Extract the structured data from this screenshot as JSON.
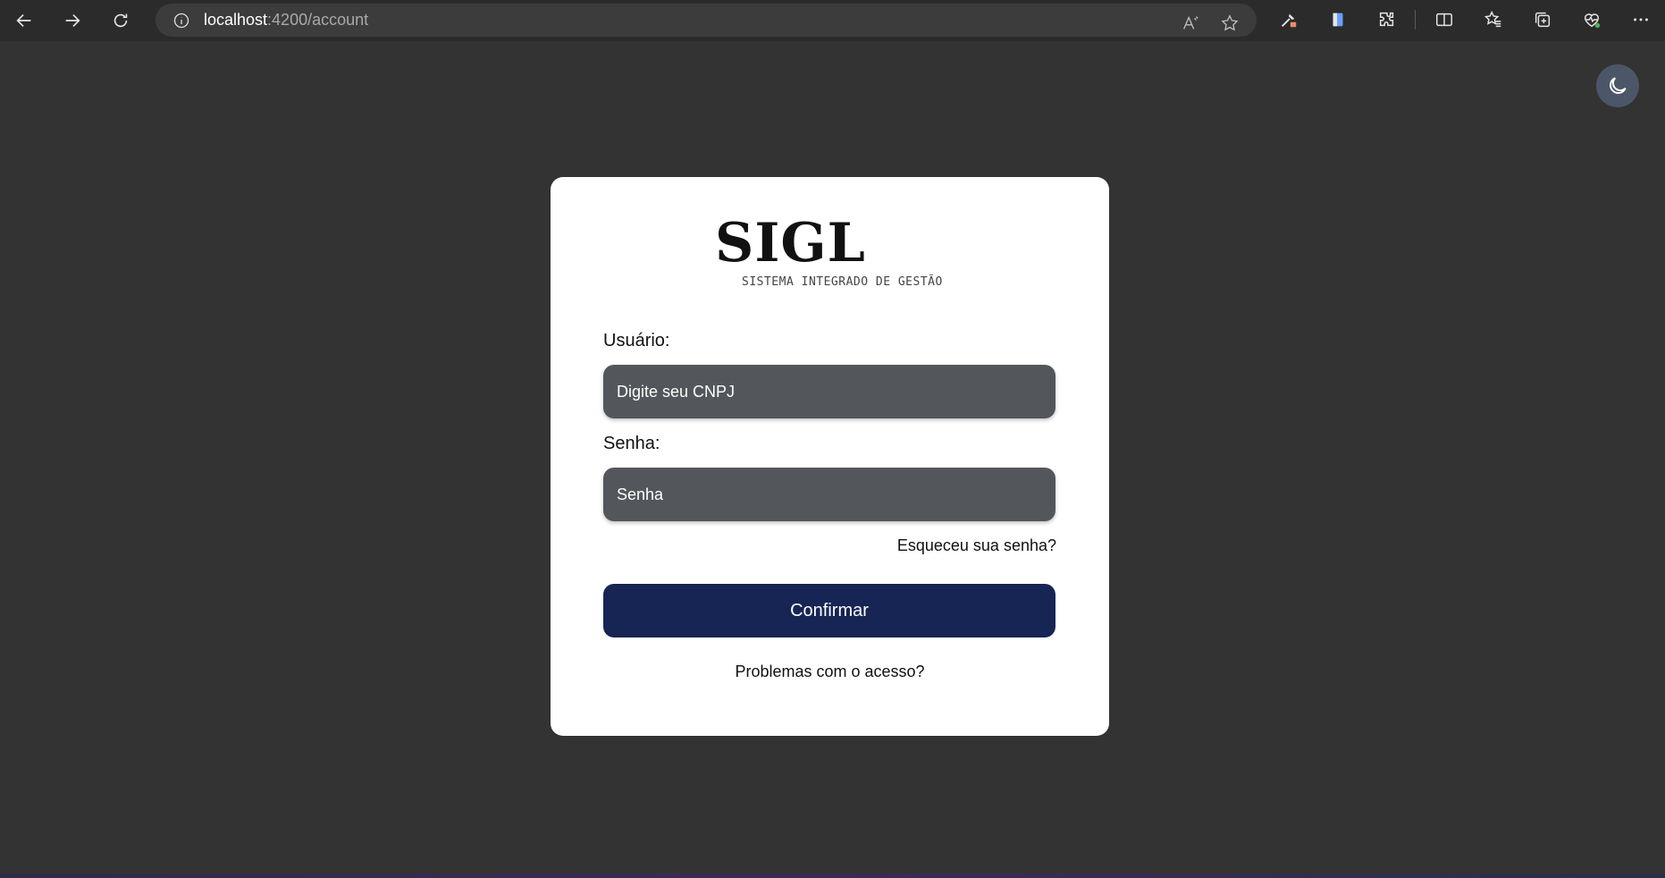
{
  "browser": {
    "url_host": "localhost",
    "url_rest": ":4200/account"
  },
  "login": {
    "logo_title": "SIGL",
    "logo_subtitle": "SISTEMA INTEGRADO DE GESTÃO",
    "user_label": "Usuário:",
    "user_placeholder": "Digite seu CNPJ",
    "password_label": "Senha:",
    "password_placeholder": "Senha",
    "forgot_link": "Esqueceu sua senha?",
    "confirm_label": "Confirmar",
    "problems_link": "Problemas com o acesso?"
  },
  "icons": {
    "theme_toggle": "moon-icon"
  },
  "colors": {
    "background": "#333333",
    "card": "#ffffff",
    "input_bg": "#53565b",
    "confirm_bg": "#172554",
    "toggle_bg": "#4b5768"
  }
}
